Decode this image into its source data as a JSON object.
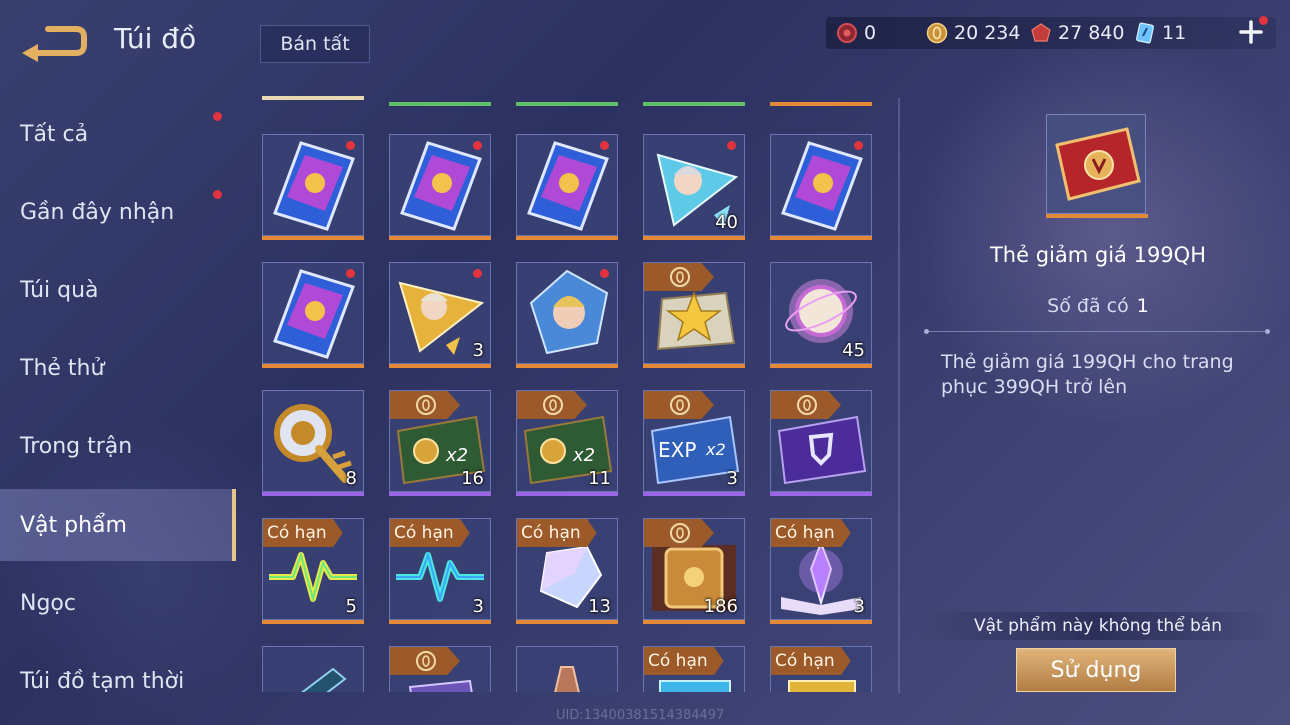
{
  "header": {
    "title": "Túi đồ",
    "sell_all_label": "Bán tất"
  },
  "currencies": [
    {
      "icon": "red-gem-icon",
      "value": "0"
    },
    {
      "icon": "gold-coin-icon",
      "value": "20 234"
    },
    {
      "icon": "ruby-icon",
      "value": "27 840"
    },
    {
      "icon": "blue-voucher-icon",
      "value": "11"
    }
  ],
  "sidebar": {
    "items": [
      {
        "label": "Tất cả",
        "badge": true
      },
      {
        "label": "Gần đây nhận",
        "badge": true
      },
      {
        "label": "Túi quà",
        "badge": false
      },
      {
        "label": "Thẻ thử",
        "badge": false
      },
      {
        "label": "Trong trận",
        "badge": false
      },
      {
        "label": "Vật phẩm",
        "badge": false,
        "active": true
      },
      {
        "label": "Ngọc",
        "badge": false
      },
      {
        "label": "Túi đồ tạm thời",
        "badge": false
      }
    ]
  },
  "grid": {
    "rows": [
      [
        {
          "name": "card-pack",
          "qty": "",
          "dot": true
        },
        {
          "name": "card-pack",
          "qty": "",
          "dot": true
        },
        {
          "name": "card-pack",
          "qty": "",
          "dot": true
        },
        {
          "name": "hero-shard-blue",
          "qty": "40",
          "dot": true
        },
        {
          "name": "card-pack",
          "qty": "",
          "dot": true
        }
      ],
      [
        {
          "name": "card-pack",
          "qty": "",
          "dot": true
        },
        {
          "name": "hero-shard-gold",
          "qty": "3",
          "dot": true
        },
        {
          "name": "hero-crystal",
          "qty": "",
          "dot": true
        },
        {
          "name": "star-badge",
          "qty": "",
          "tag": "coin"
        },
        {
          "name": "magic-orb",
          "qty": "45"
        }
      ],
      [
        {
          "name": "golden-scepter",
          "qty": "8"
        },
        {
          "name": "gold-x2-card",
          "qty": "16",
          "tag": "coin",
          "x2": "x2"
        },
        {
          "name": "gold-x2-card",
          "qty": "11",
          "tag": "coin",
          "x2": "x2"
        },
        {
          "name": "exp-x2-card",
          "qty": "3",
          "tag": "coin",
          "x2": "x2",
          "exp": "EXP"
        },
        {
          "name": "purple-emblem-card",
          "qty": "",
          "tag": "coin"
        }
      ],
      [
        {
          "name": "yellow-pulse",
          "qty": "5",
          "tag": "Có hạn"
        },
        {
          "name": "cyan-pulse",
          "qty": "3",
          "tag": "Có hạn"
        },
        {
          "name": "prism-crystal",
          "qty": "13",
          "tag": "Có hạn"
        },
        {
          "name": "treasure-chest",
          "qty": "186",
          "tag": "coin"
        },
        {
          "name": "spell-book",
          "qty": "3",
          "tag": "Có hạn"
        }
      ],
      [
        {
          "name": "scroll-item",
          "qty": ""
        },
        {
          "name": "purple-item",
          "qty": "",
          "tag": "coin"
        },
        {
          "name": "bronze-item",
          "qty": ""
        },
        {
          "name": "ticket-item",
          "qty": "",
          "tag": "Có hạn"
        },
        {
          "name": "gold-item",
          "qty": "",
          "tag": "Có hạn"
        }
      ]
    ]
  },
  "detail": {
    "name": "Thẻ giảm giá 199QH",
    "owned_label": "Số đã có",
    "owned_value": "1",
    "description": "Thẻ giảm giá 199QH cho trang phục 399QH trở lên",
    "not_sellable": "Vật phẩm này không thể bán",
    "use_label": "Sử dụng"
  },
  "footer": {
    "uid": "UID:13400381514384497"
  },
  "colors": {
    "accent_gold": "#e7c58a",
    "badge_red": "#e2343f",
    "tag_brown": "#9c5a2a",
    "rarity_orange": "#e28a3a",
    "rarity_purple": "#9a66e6",
    "rarity_green": "#5fbf6a"
  }
}
